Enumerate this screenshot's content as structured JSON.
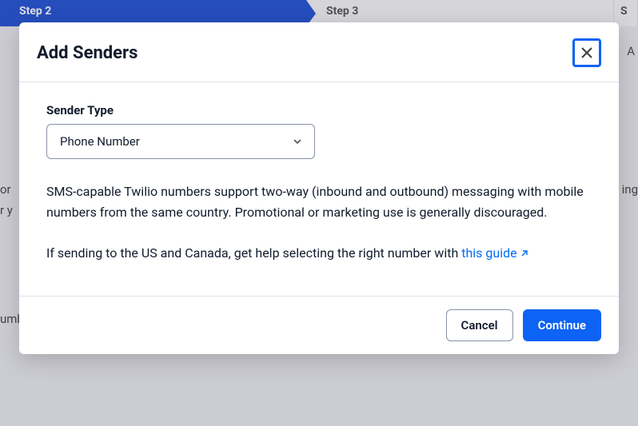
{
  "background": {
    "steps": [
      "Step 2",
      "Step 3",
      "S"
    ],
    "snippets": {
      "left1": "or",
      "left2": "r y",
      "right1": "ing",
      "bottom1": "umb",
      "right_col": "A"
    }
  },
  "modal": {
    "title": "Add Senders",
    "label_sender_type": "Sender Type",
    "select_value": "Phone Number",
    "help_paragraph1": "SMS-capable Twilio numbers support two-way (inbound and outbound) messaging with mobile numbers from the same country. Promotional or marketing use is generally discouraged.",
    "help_paragraph2_prefix": "If sending to the US and Canada, get help selecting the right number with ",
    "help_link_text": "this guide",
    "buttons": {
      "cancel": "Cancel",
      "continue": "Continue"
    }
  }
}
